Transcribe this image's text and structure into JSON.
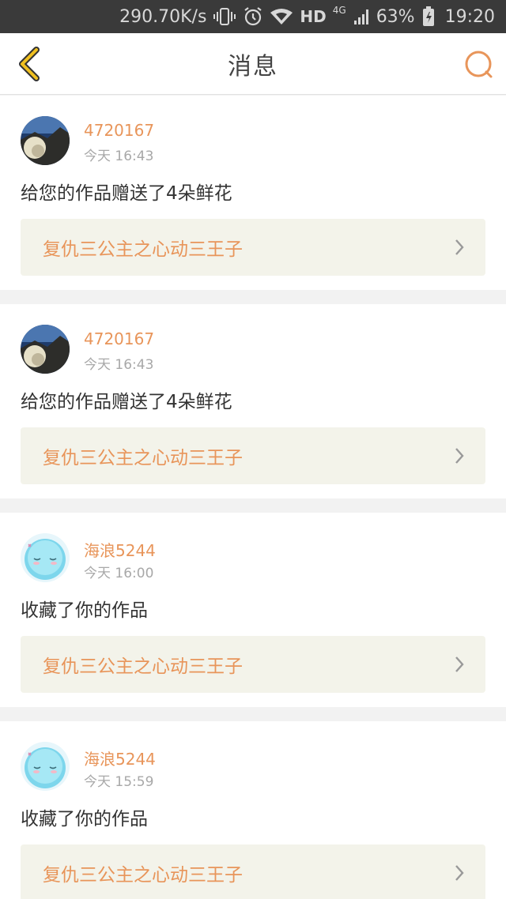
{
  "status_bar": {
    "speed": "290.70K/s",
    "network_hd": "HD",
    "network_4g": "4G",
    "battery": "63%",
    "time": "19:20"
  },
  "header": {
    "title": "消息"
  },
  "colors": {
    "accent": "#e8955a",
    "back_icon": "#f0c020",
    "card_bg": "#ffffff",
    "work_bg": "#f3f3ea"
  },
  "messages": [
    {
      "username": "4720167",
      "time": "今天 16:43",
      "action": "给您的作品赠送了4朵鲜花",
      "work_title": "复仇三公主之心动三王子",
      "avatar": "landscape-photo"
    },
    {
      "username": "4720167",
      "time": "今天 16:43",
      "action": "给您的作品赠送了4朵鲜花",
      "work_title": "复仇三公主之心动三王子",
      "avatar": "landscape-photo"
    },
    {
      "username": "海浪5244",
      "time": "今天 16:00",
      "action": "收藏了你的作品",
      "work_title": "复仇三公主之心动三王子",
      "avatar": "cartoon-face"
    },
    {
      "username": "海浪5244",
      "time": "今天 15:59",
      "action": "收藏了你的作品",
      "work_title": "复仇三公主之心动三王子",
      "avatar": "cartoon-face"
    }
  ]
}
